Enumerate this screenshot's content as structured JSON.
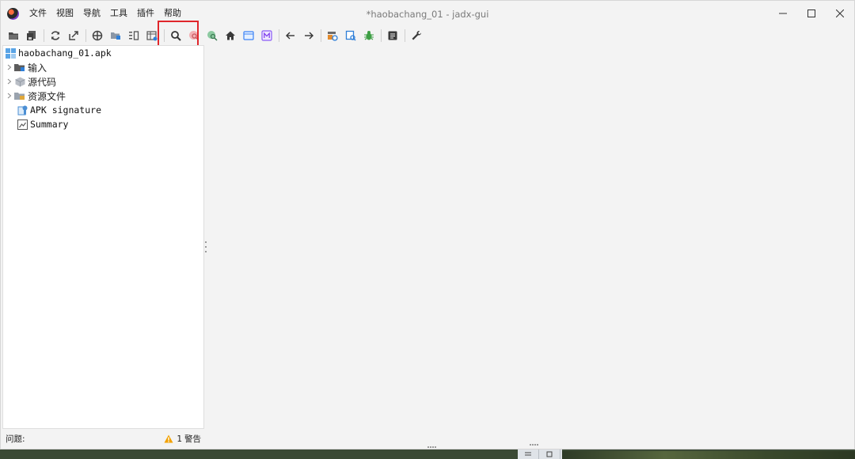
{
  "window": {
    "title": "*haobachang_01 - jadx-gui"
  },
  "menu": {
    "items": [
      "文件",
      "视图",
      "导航",
      "工具",
      "插件",
      "帮助"
    ]
  },
  "toolbar": {
    "buttons": [
      "open-folder-icon",
      "save-all-icon",
      "sync-icon",
      "export-icon",
      "sync-classes-icon",
      "folder-grid-icon",
      "split-view-icon",
      "table-icon",
      "search-icon",
      "search-usage-icon",
      "text-search-icon",
      "home-icon",
      "window-icon",
      "memory-icon",
      "back-arrow-icon",
      "forward-arrow-icon",
      "resources-icon",
      "decompile-icon",
      "debug-bug-icon",
      "log-icon",
      "wrench-icon"
    ]
  },
  "tree": {
    "root": "haobachang_01.apk",
    "items": [
      {
        "label": "输入",
        "icon": "input-folder-icon"
      },
      {
        "label": "源代码",
        "icon": "source-package-icon"
      },
      {
        "label": "资源文件",
        "icon": "resource-folder-icon"
      },
      {
        "label": "APK signature",
        "icon": "certificate-icon"
      },
      {
        "label": "Summary",
        "icon": "summary-chart-icon"
      }
    ]
  },
  "status": {
    "issues_label": "问题:",
    "warning_count": "1",
    "warning_label": "警告"
  },
  "colors": {
    "highlight_box": "#e0262b",
    "warning": "#f2a100"
  }
}
